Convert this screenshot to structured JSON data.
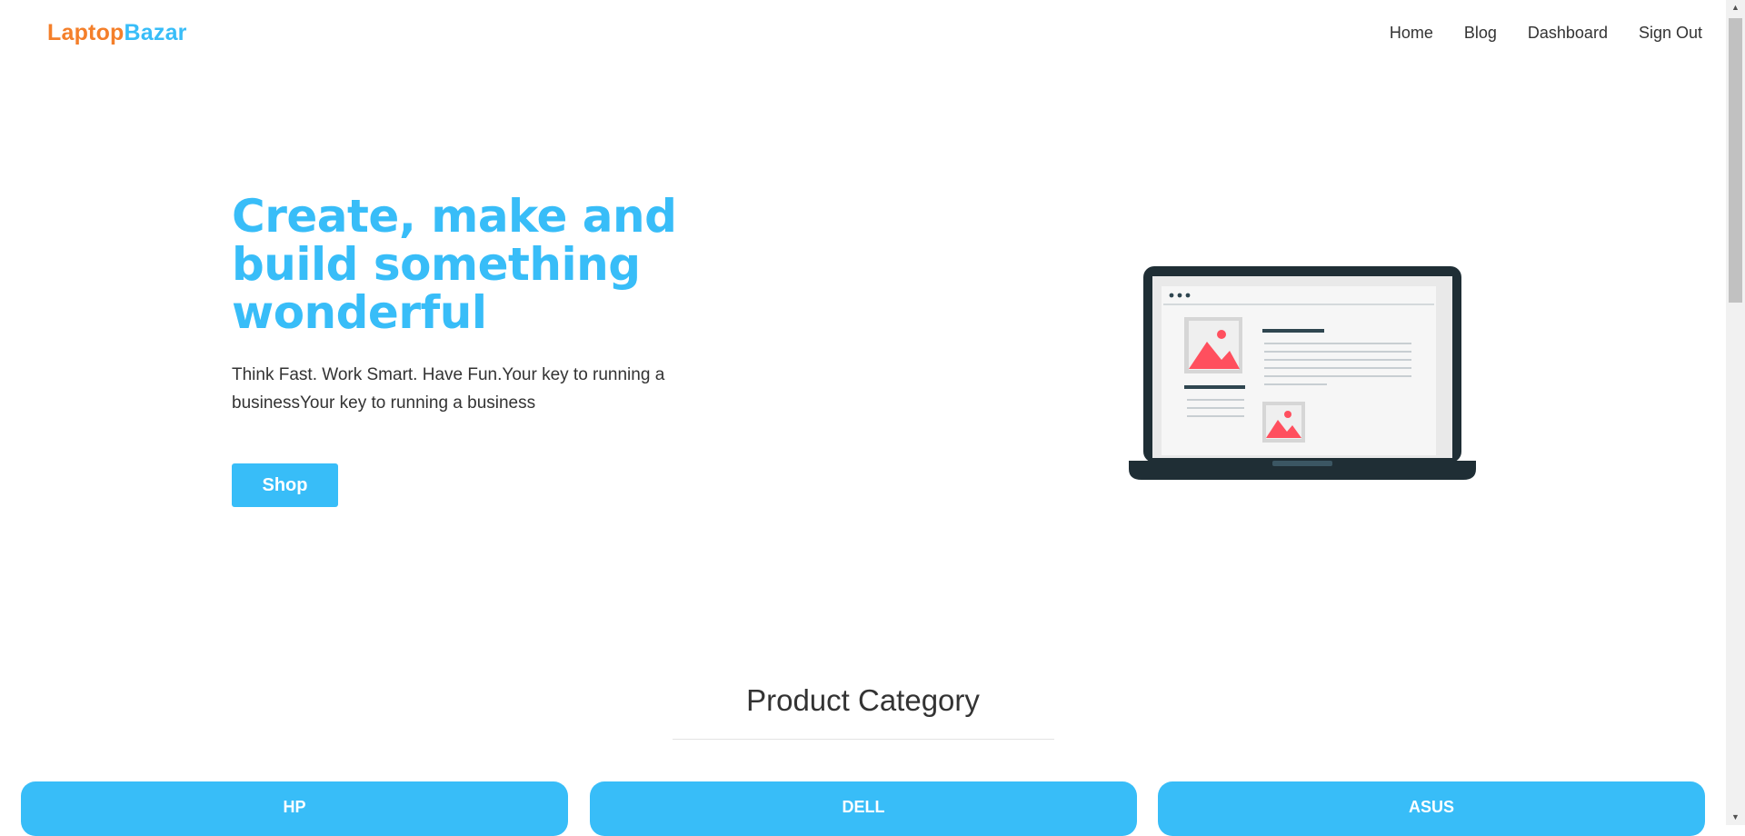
{
  "brand": {
    "part1": "Laptop",
    "part2": "Bazar"
  },
  "nav": {
    "home": "Home",
    "blog": "Blog",
    "dashboard": "Dashboard",
    "signout": "Sign Out"
  },
  "hero": {
    "title": "Create, make and build something wonderful",
    "text": "Think Fast. Work Smart. Have Fun.Your key to running a businessYour key to running a business",
    "button": "Shop",
    "illustration_icon": "laptop-illustration-icon"
  },
  "category": {
    "title": "Product Category",
    "items": [
      "HP",
      "DELL",
      "ASUS"
    ]
  },
  "colors": {
    "accent": "#38bdf8",
    "brand_orange": "#f47f2a",
    "laptop_dark": "#1f2e35",
    "image_red": "#ff4f5e"
  },
  "icons": {
    "scroll_up": "chevron-up-icon",
    "scroll_down": "chevron-down-icon"
  }
}
